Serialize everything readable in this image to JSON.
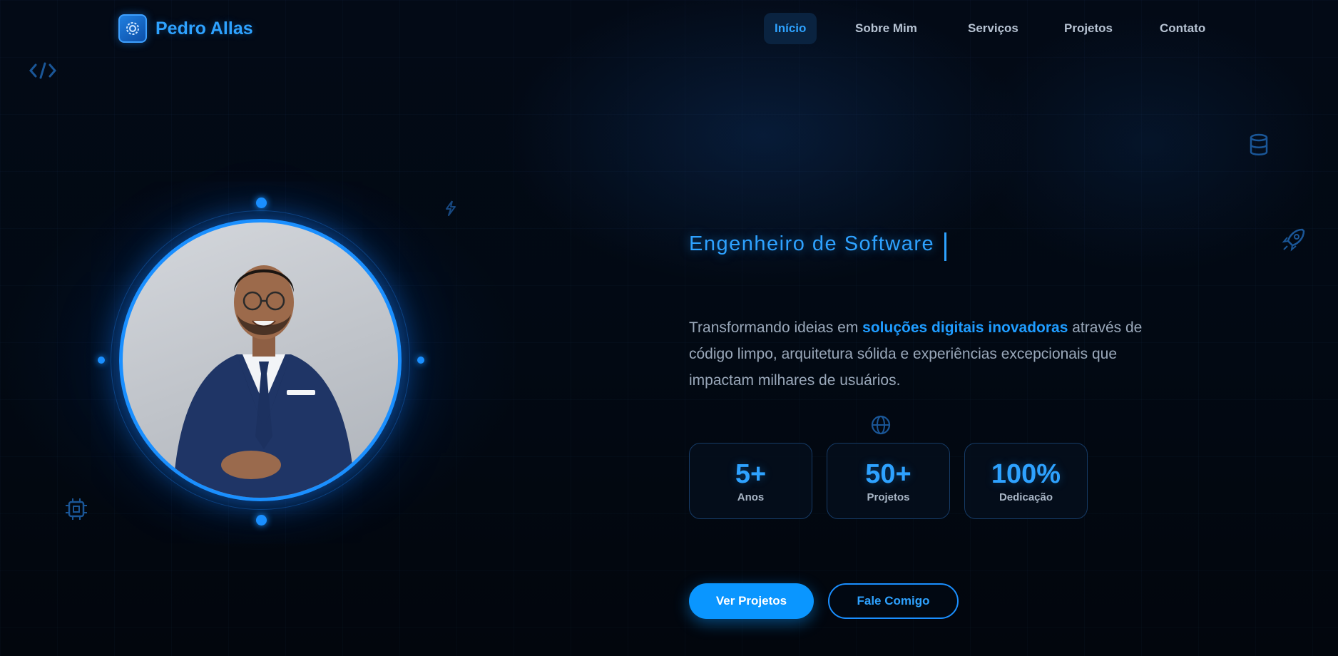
{
  "brand": {
    "name": "Pedro Allas",
    "logo_icon": "gear-icon"
  },
  "nav": {
    "items": [
      {
        "label": "Início",
        "active": true
      },
      {
        "label": "Sobre Mim",
        "active": false
      },
      {
        "label": "Serviços",
        "active": false
      },
      {
        "label": "Projetos",
        "active": false
      },
      {
        "label": "Contato",
        "active": false
      }
    ]
  },
  "hero": {
    "role": "Engenheiro de Software",
    "description": {
      "before": "Transformando ideias em ",
      "highlight": "soluções digitais inovadoras",
      "after": " através de código limpo, arquitetura sólida e experiências excepcionais que impactam milhares de usuários."
    },
    "stats": [
      {
        "value": "5+",
        "label": "Anos"
      },
      {
        "value": "50+",
        "label": "Projetos"
      },
      {
        "value": "100%",
        "label": "Dedicação"
      }
    ],
    "primary_button": "Ver Projetos",
    "secondary_button": "Fale Comigo"
  },
  "profile": {
    "photo_icon": "person-photo"
  },
  "decorations": [
    "code-icon",
    "lightning-icon",
    "chip-icon",
    "database-icon",
    "rocket-icon",
    "globe-icon"
  ],
  "colors": {
    "accent": "#1a8fff",
    "background": "#02070f",
    "text_muted": "#9aa8ba"
  }
}
